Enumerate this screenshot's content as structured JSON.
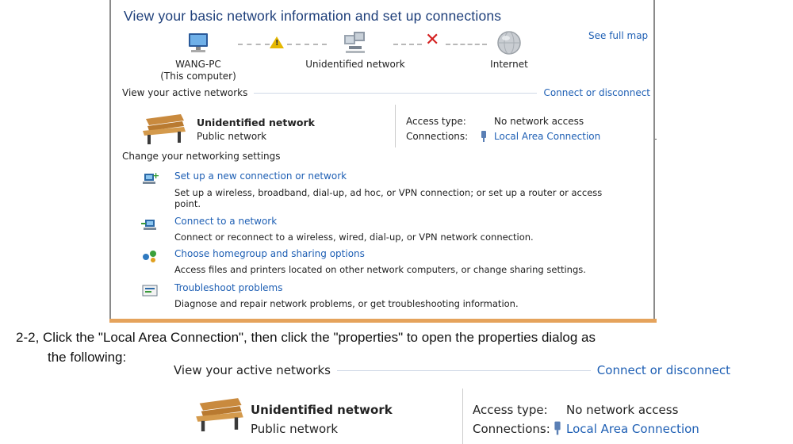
{
  "panel1": {
    "title": "View your basic network information and set up connections",
    "see_full_map": "See full map",
    "map": {
      "computer_name": "WANG-PC",
      "computer_sub": "(This computer)",
      "network": "Unidentified network",
      "internet": "Internet"
    },
    "active_networks": {
      "label": "View your active networks",
      "connect_link": "Connect or disconnect",
      "network_name": "Unidentified network",
      "network_type": "Public network",
      "access_type_label": "Access type:",
      "access_type_value": "No network access",
      "connections_label": "Connections:",
      "connections_value": "Local Area Connection"
    },
    "change_settings": {
      "label": "Change your networking settings",
      "tasks": [
        {
          "title": "Set up a new connection or network",
          "desc": "Set up a wireless, broadband, dial-up, ad hoc, or VPN connection; or set up a router or access point.",
          "icon": "new-connection-icon"
        },
        {
          "title": "Connect to a network",
          "desc": "Connect or reconnect to a wireless, wired, dial-up, or VPN network connection.",
          "icon": "connect-network-icon"
        },
        {
          "title": "Choose homegroup and sharing options",
          "desc": "Access files and printers located on other network computers, or change sharing settings.",
          "icon": "homegroup-icon"
        },
        {
          "title": "Troubleshoot problems",
          "desc": "Diagnose and repair network problems, or get troubleshooting information.",
          "icon": "troubleshoot-icon"
        }
      ]
    }
  },
  "instruction": {
    "line1": "2-2, Click the \"Local Area Connection\", then click the \"properties\" to open the properties dialog as",
    "line2": "the following:"
  },
  "panel2": {
    "label": "View your active networks",
    "connect_link": "Connect or disconnect",
    "network_name": "Unidentified network",
    "network_type": "Public network",
    "access_type_label": "Access type:",
    "access_type_value": "No network access",
    "connections_label": "Connections:",
    "connections_value": "Local Area Connection"
  },
  "colors": {
    "link": "#1e5fb4",
    "title": "#1e3f7a",
    "accent_border": "#e5a35c",
    "error": "#d42020",
    "warning": "#e6b800"
  }
}
